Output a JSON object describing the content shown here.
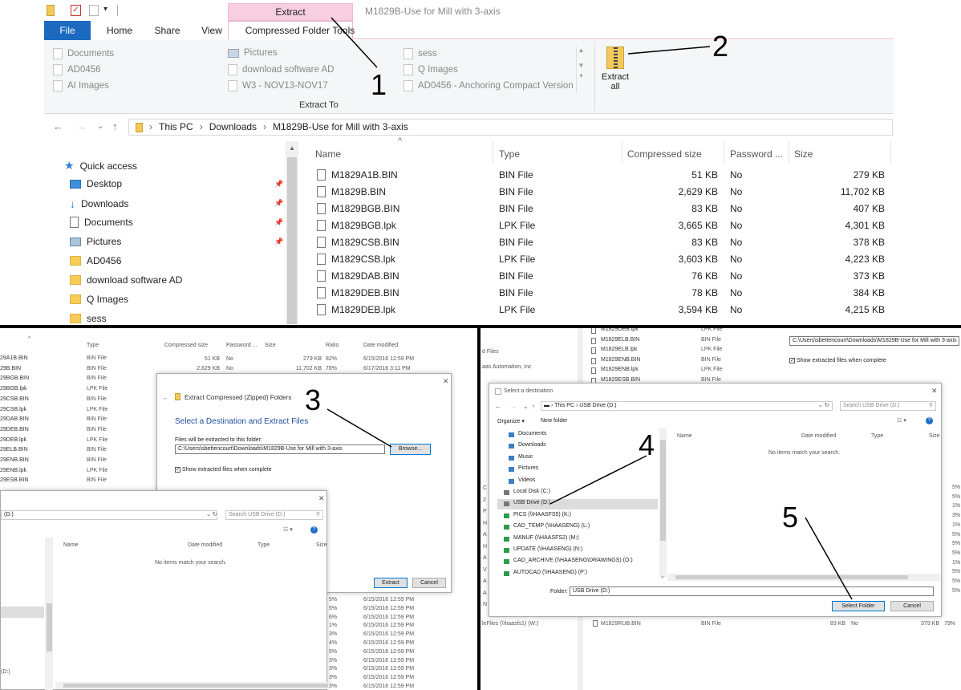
{
  "ribbon": {
    "context_tab": "Extract",
    "window_title": "M1829B-Use for Mill with 3-axis",
    "tabs": [
      "File",
      "Home",
      "Share",
      "View",
      "Compressed Folder Tools"
    ],
    "destinations": [
      [
        "Documents",
        "Pictures",
        "sess"
      ],
      [
        "AD0456",
        "download software AD",
        "Q Images"
      ],
      [
        "AI Images",
        "W3 - NOV13-NOV17",
        "AD0456 - Anchoring Compact Version"
      ]
    ],
    "extract_all": "Extract all",
    "group_label": "Extract To"
  },
  "address": {
    "crumbs": [
      "This PC",
      "Downloads",
      "M1829B-Use for Mill with 3-axis"
    ]
  },
  "nav": {
    "quick_access": "Quick access",
    "items": [
      "Desktop",
      "Downloads",
      "Documents",
      "Pictures",
      "AD0456",
      "download software AD",
      "Q Images",
      "sess"
    ]
  },
  "filelist": {
    "columns": [
      "Name",
      "Type",
      "Compressed size",
      "Password ...",
      "Size"
    ],
    "rows": [
      [
        "M1829A1B.BIN",
        "BIN File",
        "51 KB",
        "No",
        "279 KB"
      ],
      [
        "M1829B.BIN",
        "BIN File",
        "2,629 KB",
        "No",
        "11,702 KB"
      ],
      [
        "M1829BGB.BIN",
        "BIN File",
        "83 KB",
        "No",
        "407 KB"
      ],
      [
        "M1829BGB.lpk",
        "LPK File",
        "3,665 KB",
        "No",
        "4,301 KB"
      ],
      [
        "M1829CSB.BIN",
        "BIN File",
        "83 KB",
        "No",
        "378 KB"
      ],
      [
        "M1829CSB.lpk",
        "LPK File",
        "3,603 KB",
        "No",
        "4,223 KB"
      ],
      [
        "M1829DAB.BIN",
        "BIN File",
        "76 KB",
        "No",
        "373 KB"
      ],
      [
        "M1829DEB.BIN",
        "BIN File",
        "78 KB",
        "No",
        "384 KB"
      ],
      [
        "M1829DEB.lpk",
        "LPK File",
        "3,594 KB",
        "No",
        "4,215 KB"
      ]
    ]
  },
  "callouts": [
    "1",
    "2",
    "3",
    "4",
    "5"
  ],
  "panel3": {
    "columns": [
      "Type",
      "Compressed size",
      "Password ...",
      "Size",
      "Ratio",
      "Date modified"
    ],
    "names": [
      "29A1B.BIN",
      "29B.BIN",
      "29BGB.BIN",
      "29BGB.lpk",
      "29CSB.BIN",
      "29CSB.lpk",
      "29DAB.BIN",
      "29DEB.BIN",
      "29DEB.lpk",
      "29ELB.BIN",
      "29ENB.BIN",
      "29ENB.lpk",
      "29ESB.BIN"
    ],
    "types": [
      "BIN File",
      "BIN File",
      "BIN File",
      "LPK File",
      "BIN File",
      "LPK File",
      "BIN File",
      "BIN File",
      "LPK File",
      "BIN File",
      "BIN File",
      "LPK File",
      "BIN File"
    ],
    "row1": [
      "51 KB",
      "No",
      "279 KB",
      "82%",
      "6/15/2016 12:59 PM"
    ],
    "row2": [
      "2,629 KB",
      "No",
      "11,702 KB",
      "78%",
      "6/17/2016 3:11 PM"
    ],
    "extract_title": "Extract Compressed (Zipped) Folders",
    "heading": "Select a Destination and Extract Files",
    "field_label": "Files will be extracted to this folder:",
    "path": "C:\\Users\\sbettencourt\\Downloads\\M1829B-Use for Mill with 3-axis",
    "browse": "Browse...",
    "show_files": "Show extracted files when complete",
    "extract_btn": "Extract",
    "cancel_btn": "Cancel",
    "drive_addr": "(D:)",
    "search": "Search USB Drive (D:)",
    "inner_cols": [
      "Name",
      "Date modified",
      "Type",
      "Size"
    ],
    "empty": "No items match your search.",
    "bottom_drive": "(D:)",
    "pcts": [
      "5%",
      "5%",
      "6%",
      "1%",
      "3%",
      "4%",
      "5%",
      "3%",
      "3%",
      "3%",
      "3%"
    ],
    "date": "6/15/2016 12:59 PM"
  },
  "panel4": {
    "top_names": [
      "M1829DEB.lpk",
      "M1829ELB.BIN",
      "M1829ELB.lpk",
      "M1829ENB.BIN",
      "M1829ENB.lpk",
      "M1829ESB.BIN"
    ],
    "top_types": [
      "LPK File",
      "BIN File",
      "LPK File",
      "BIN File",
      "LPK File",
      "BIN File"
    ],
    "left_texts": [
      "d Files",
      "aas Automation, Inc"
    ],
    "path": "C:\\Users\\sbettencourt\\Downloads\\M1829B-Use for Mill with 3-axis",
    "show_files": "Show extracted files when complete",
    "dialog_title": "Select a destination",
    "crumbs": [
      "This PC",
      "USB Drive (D:)"
    ],
    "search": "Search USB Drive (D:)",
    "organize": "Organize",
    "new_folder": "New folder",
    "tree": [
      "Documents",
      "Downloads",
      "Music",
      "Pictures",
      "Videos",
      "Local Disk (C:)",
      "USB Drive (D:)",
      "PICS (\\\\HAASFS5) (K:)",
      "CAD_TEMP (\\\\HAASENG) (L:)",
      "MANUF (\\\\HAASFS2) (M:)",
      "UPDATE (\\\\HAASENG) (N:)",
      "CAD_ARCHIVE (\\\\HAASENG\\DRAWINGS) (O:)",
      "AUTOCAD (\\\\HAASENG) (P:)"
    ],
    "cols": [
      "Name",
      "Date modified",
      "Type",
      "Size"
    ],
    "empty": "No items match your search.",
    "folder_label": "Folder:",
    "folder_value": "USB Drive (D:)",
    "select_btn": "Select Folder",
    "cancel_btn": "Cancel",
    "bottom_left": "leFiles (\\\\haasfs1) (W:)",
    "bottom_row": [
      "M1829RUB.BIN",
      "BIN File",
      "83 KB",
      "No",
      "379 KB",
      "79%"
    ],
    "right_pcts": [
      "5%",
      "5%",
      "1%",
      "3%",
      "1%",
      "5%",
      "5%",
      "5%",
      "1%",
      "5%",
      "5%",
      "5%"
    ],
    "left_chars": [
      "C",
      "2",
      "P",
      "H",
      "A",
      "H",
      "A",
      "V",
      "A",
      "A",
      "N"
    ]
  }
}
